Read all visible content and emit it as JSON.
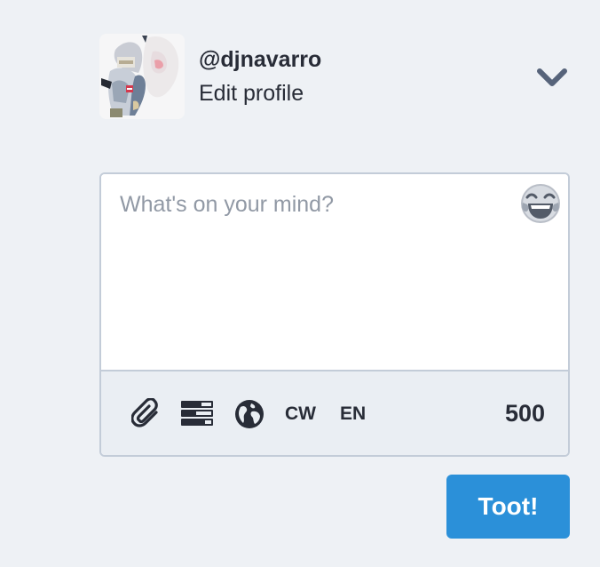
{
  "account": {
    "handle": "@djnavarro",
    "edit_profile_label": "Edit profile"
  },
  "composer": {
    "placeholder": "What's on your mind?",
    "value": ""
  },
  "toolbar": {
    "content_warning_label": "CW",
    "language_label": "EN",
    "character_counter": "500"
  },
  "actions": {
    "submit_label": "Toot!"
  },
  "icons": {
    "dropdown": "chevron-down-icon",
    "emoji": "laughing-emoji-icon",
    "attach": "paperclip-icon",
    "poll": "poll-icon",
    "visibility": "globe-icon"
  },
  "colors": {
    "page_background": "#eef1f5",
    "text": "#282c37",
    "placeholder": "#9199a5",
    "border": "#c3ccd8",
    "toolbar_background": "#eaeef3",
    "accent": "#2b90d9",
    "chevron": "#56637a"
  }
}
